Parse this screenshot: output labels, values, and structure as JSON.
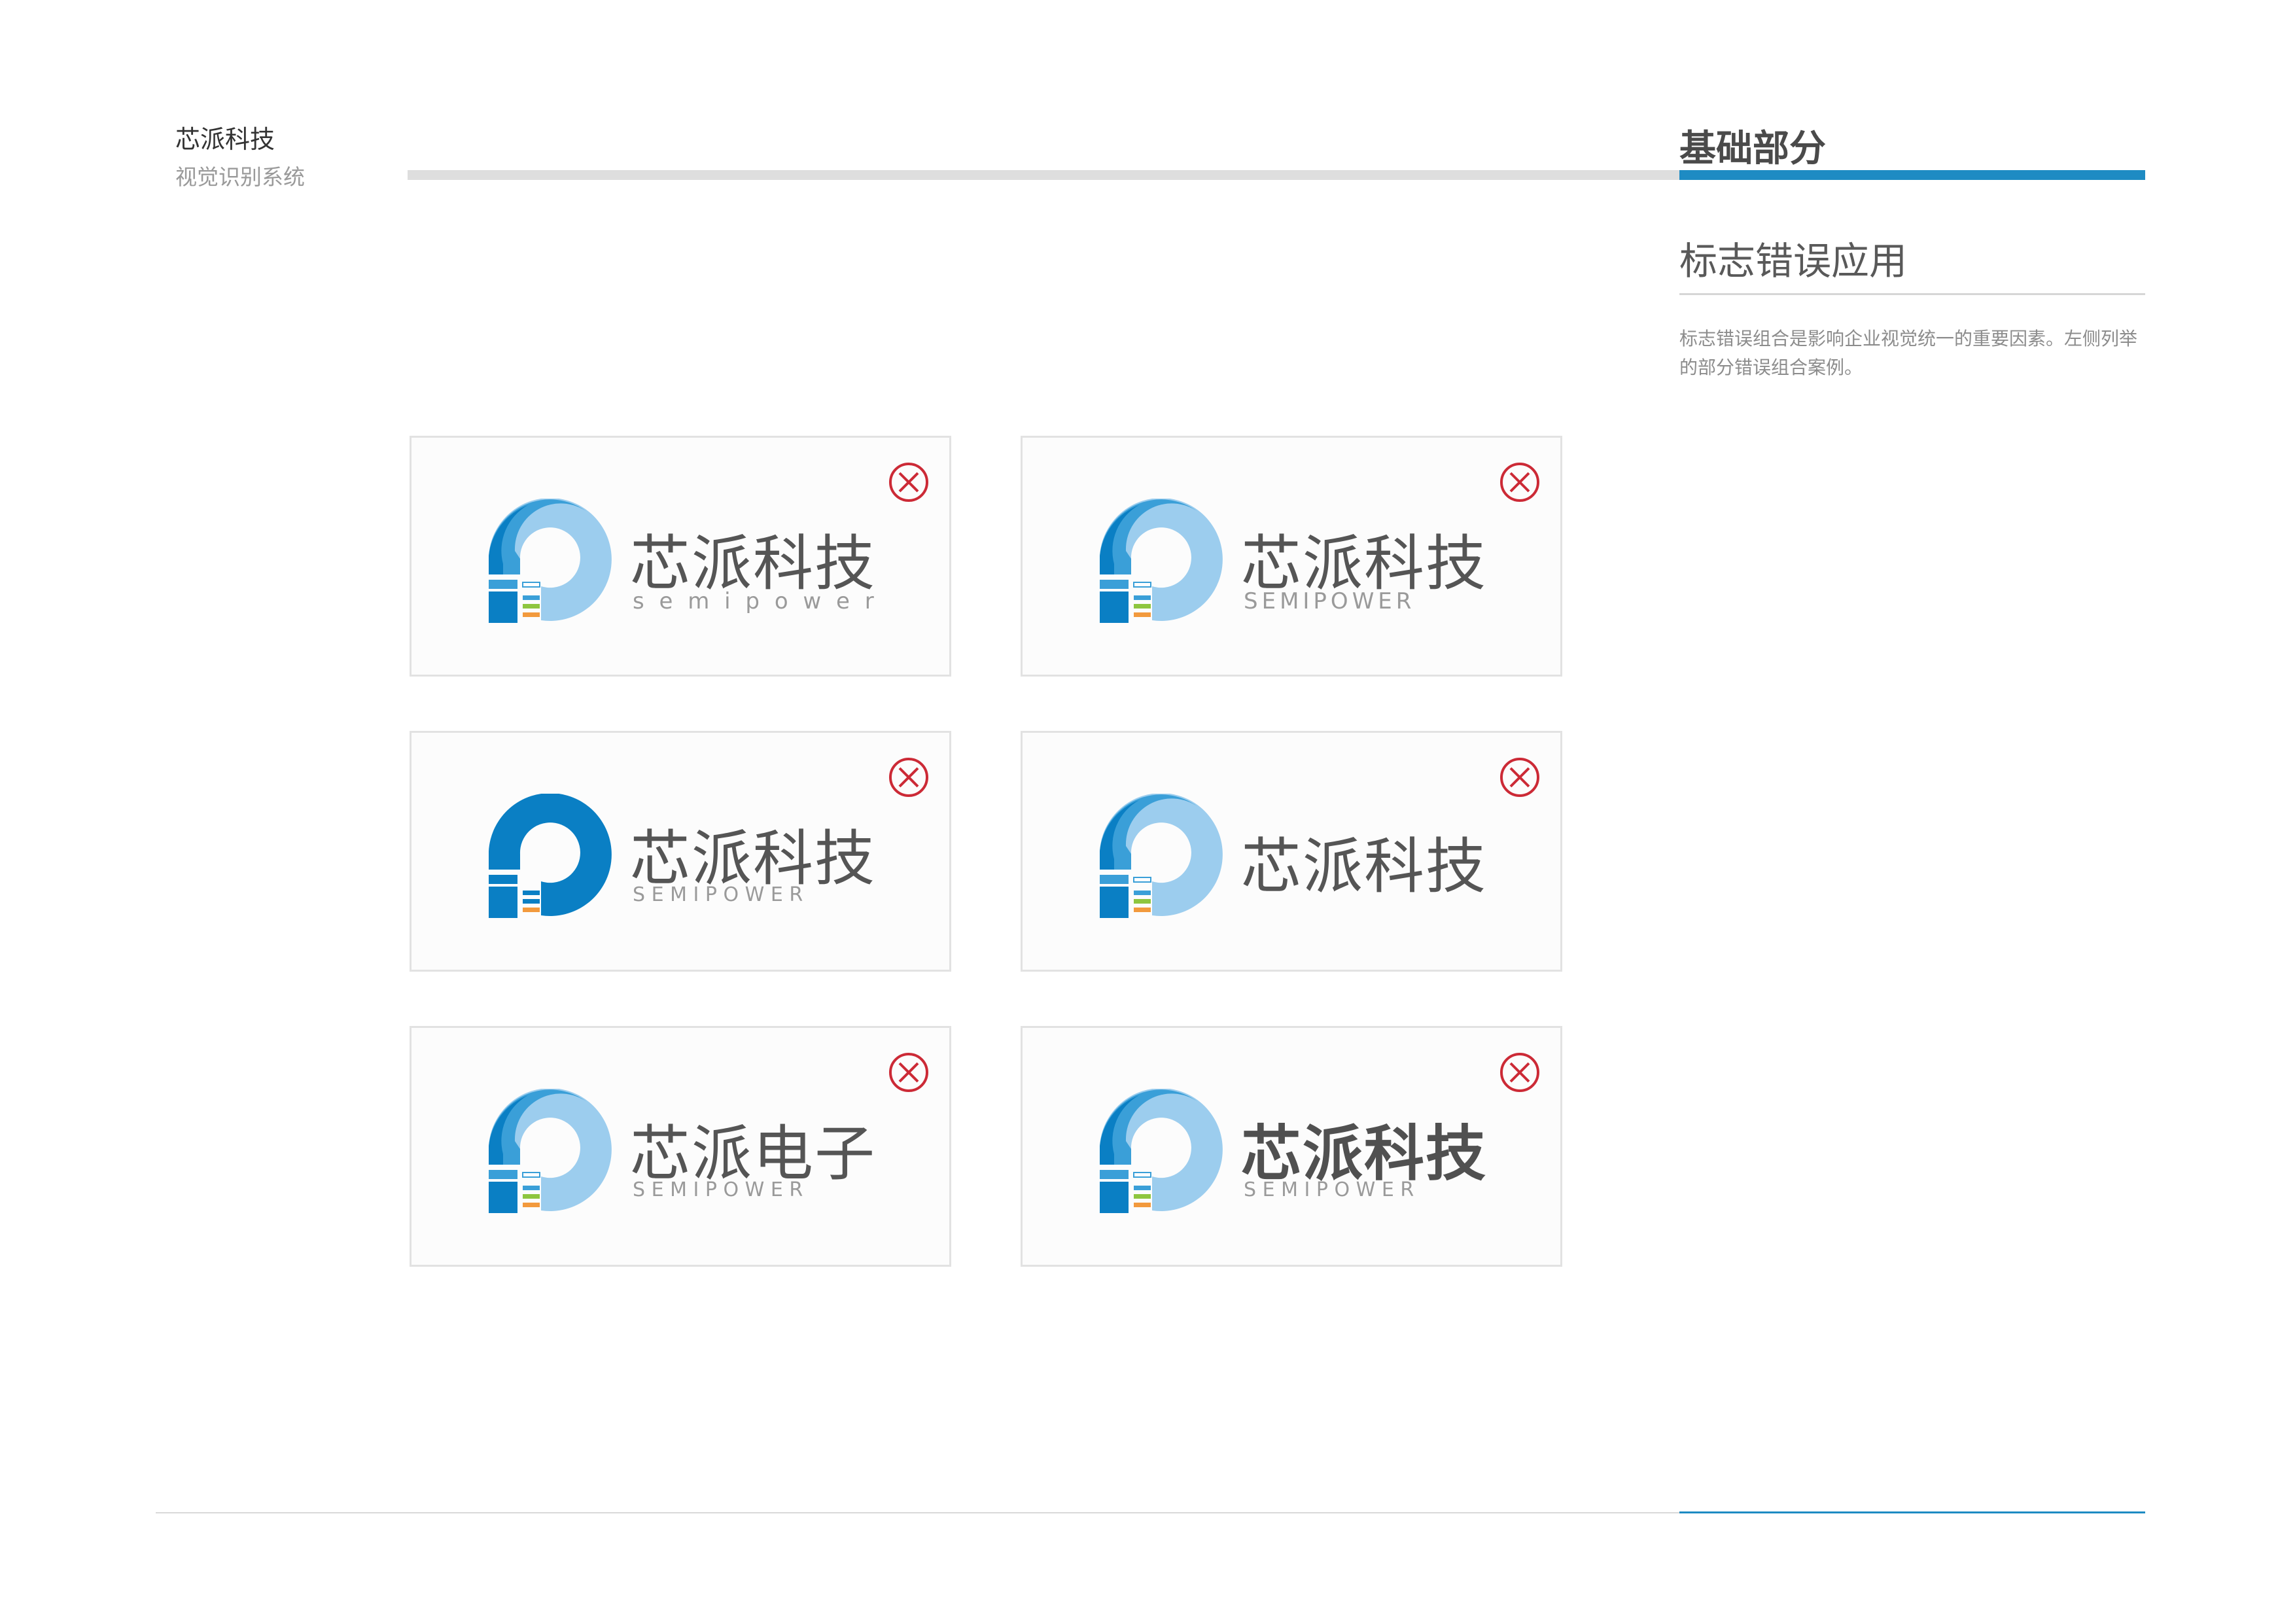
{
  "header": {
    "brand_name": "芯派科技",
    "brand_subtitle": "视觉识别系统",
    "section_title": "基础部分",
    "accent_color": "#1e8bc3"
  },
  "content": {
    "subtitle": "标志错误应用",
    "description": "标志错误组合是影响企业视觉统一的重要因素。左侧列举的部分错误组合案例。"
  },
  "examples": [
    {
      "name": "芯派科技",
      "tagline": "s e m i p o w e r",
      "status_icon": "wrong-icon"
    },
    {
      "name": "芯派科技",
      "tagline": "SEMIPOWER",
      "status_icon": "wrong-icon"
    },
    {
      "name": "芯派科技",
      "tagline": "S E M I P O W E R",
      "status_icon": "wrong-icon"
    },
    {
      "name": "芯派科技",
      "tagline": "",
      "status_icon": "wrong-icon"
    },
    {
      "name": "芯派电子",
      "tagline": "S E M I P O W E R",
      "status_icon": "wrong-icon"
    },
    {
      "name": "芯派科技",
      "tagline": "S E M I P O W E R",
      "status_icon": "wrong-icon"
    }
  ],
  "colors": {
    "logo_dark_blue": "#0a7fc4",
    "logo_mid_blue": "#3a9fd8",
    "logo_light_blue": "#9ccdee",
    "error_red": "#cc2a36"
  }
}
